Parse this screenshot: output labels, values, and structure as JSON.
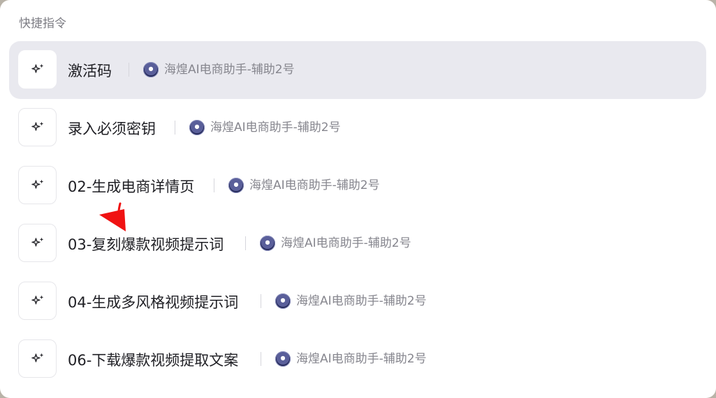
{
  "header": {
    "title": "快捷指令"
  },
  "commands": [
    {
      "label": "激活码",
      "bot": "海煌AI电商助手-辅助2号"
    },
    {
      "label": "录入必须密钥",
      "bot": "海煌AI电商助手-辅助2号"
    },
    {
      "label": "02-生成电商详情页",
      "bot": "海煌AI电商助手-辅助2号"
    },
    {
      "label": "03-复刻爆款视频提示词",
      "bot": "海煌AI电商助手-辅助2号"
    },
    {
      "label": "04-生成多风格视频提示词",
      "bot": "海煌AI电商助手-辅助2号"
    },
    {
      "label": "06-下载爆款视频提取文案",
      "bot": "海煌AI电商助手-辅助2号"
    }
  ],
  "colors": {
    "active_row": "#e9e9ef",
    "annotation_arrow": "#f01212"
  },
  "icons": {
    "command": "sparkle-icon",
    "bot": "bot-avatar-icon",
    "annotation": "red-arrow-icon"
  }
}
